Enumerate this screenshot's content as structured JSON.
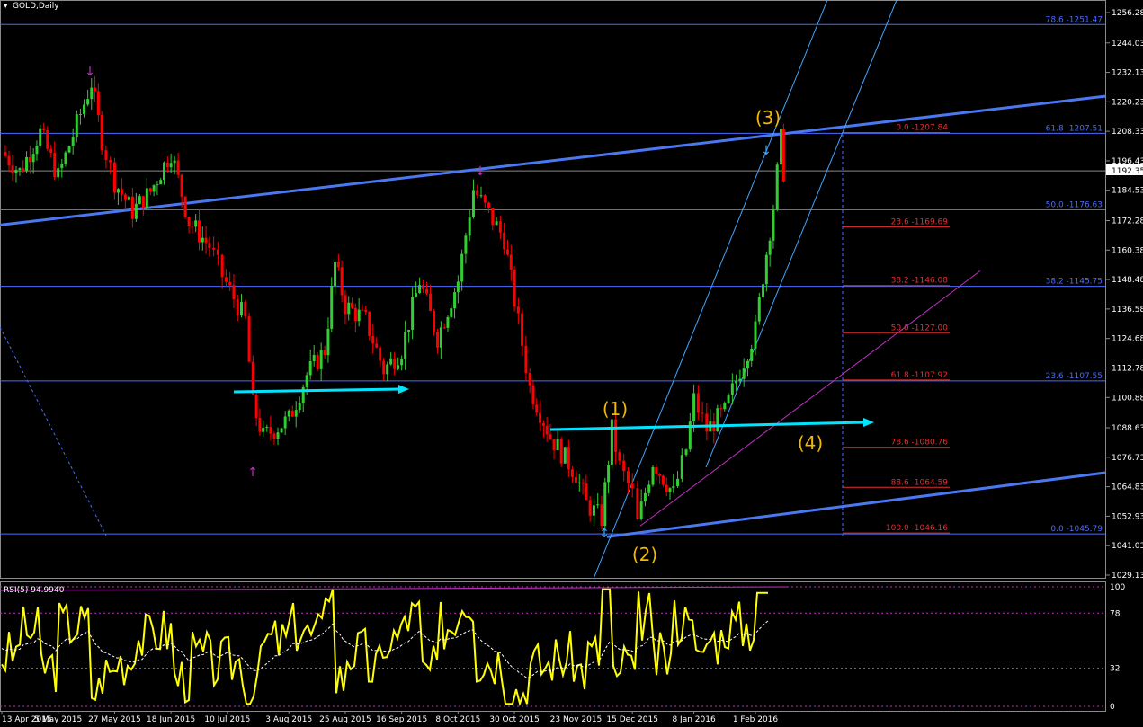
{
  "title": "GOLD,Daily",
  "indicator": {
    "label": "RSI(5) 94.9940"
  },
  "current_price": "1192.35",
  "colors": {
    "background": "#000000",
    "bull_candle": "#32cd32",
    "bear_candle": "#ff0000",
    "fib_blue": "#4a6cff",
    "fib_red": "#e23030",
    "trendline": "#4a78f0",
    "channel": "#40a6ff",
    "arrow": "#00e5ff",
    "wave_label": "#f5b800",
    "rsi": "#ffff00",
    "fractal": "#c030c0",
    "axis_text": "#ffffff"
  },
  "chart_data": {
    "type": "candlestick",
    "title": "GOLD,Daily",
    "ylim": [
      1024,
      1262
    ],
    "y_ticks": [
      "1256.28",
      "1244.03",
      "1232.13",
      "1220.23",
      "1208.33",
      "1196.43",
      "1184.53",
      "1172.28",
      "1160.38",
      "1148.48",
      "1136.58",
      "1124.68",
      "1112.78",
      "1100.88",
      "1088.63",
      "1076.73",
      "1064.83",
      "1052.93",
      "1041.03",
      "1029.13"
    ],
    "x_ticks": [
      "13 Apr 2015",
      "5 May 2015",
      "27 May 2015",
      "18 Jun 2015",
      "10 Jul 2015",
      "3 Aug 2015",
      "25 Aug 2015",
      "16 Sep 2015",
      "8 Oct 2015",
      "30 Oct 2015",
      "23 Nov 2015",
      "15 Dec 2015",
      "8 Jan 2016",
      "1 Feb 2016"
    ],
    "close_path": [
      {
        "date": "13 Apr 2015",
        "close": 1200
      },
      {
        "date": "20 Apr 2015",
        "close": 1192
      },
      {
        "date": "28 Apr 2015",
        "close": 1208
      },
      {
        "date": "5 May 2015",
        "close": 1190
      },
      {
        "date": "18 May 2015",
        "close": 1228
      },
      {
        "date": "22 May 2015",
        "close": 1205
      },
      {
        "date": "27 May 2015",
        "close": 1188
      },
      {
        "date": "3 Jun 2015",
        "close": 1176
      },
      {
        "date": "10 Jun 2015",
        "close": 1184
      },
      {
        "date": "18 Jun 2015",
        "close": 1200
      },
      {
        "date": "25 Jun 2015",
        "close": 1172
      },
      {
        "date": "3 Jul 2015",
        "close": 1162
      },
      {
        "date": "8 Jul 2015",
        "close": 1150
      },
      {
        "date": "17 Jul 2015",
        "close": 1132
      },
      {
        "date": "20 Jul 2015",
        "close": 1098
      },
      {
        "date": "24 Jul 2015",
        "close": 1085
      },
      {
        "date": "3 Aug 2015",
        "close": 1092
      },
      {
        "date": "10 Aug 2015",
        "close": 1110
      },
      {
        "date": "17 Aug 2015",
        "close": 1120
      },
      {
        "date": "21 Aug 2015",
        "close": 1155
      },
      {
        "date": "25 Aug 2015",
        "close": 1138
      },
      {
        "date": "2 Sep 2015",
        "close": 1132
      },
      {
        "date": "9 Sep 2015",
        "close": 1112
      },
      {
        "date": "16 Sep 2015",
        "close": 1120
      },
      {
        "date": "23 Sep 2015",
        "close": 1148
      },
      {
        "date": "30 Sep 2015",
        "close": 1125
      },
      {
        "date": "8 Oct 2015",
        "close": 1148
      },
      {
        "date": "14 Oct 2015",
        "close": 1185
      },
      {
        "date": "20 Oct 2015",
        "close": 1175
      },
      {
        "date": "26 Oct 2015",
        "close": 1165
      },
      {
        "date": "30 Oct 2015",
        "close": 1140
      },
      {
        "date": "5 Nov 2015",
        "close": 1105
      },
      {
        "date": "13 Nov 2015",
        "close": 1085
      },
      {
        "date": "23 Nov 2015",
        "close": 1070
      },
      {
        "date": "27 Nov 2015",
        "close": 1058
      },
      {
        "date": "3 Dec 2015",
        "close": 1052
      },
      {
        "date": "7 Dec 2015",
        "close": 1088
      },
      {
        "date": "10 Dec 2015",
        "close": 1073
      },
      {
        "date": "15 Dec 2015",
        "close": 1062
      },
      {
        "date": "17 Dec 2015",
        "close": 1050
      },
      {
        "date": "23 Dec 2015",
        "close": 1075
      },
      {
        "date": "31 Dec 2015",
        "close": 1062
      },
      {
        "date": "5 Jan 2016",
        "close": 1080
      },
      {
        "date": "8 Jan 2016",
        "close": 1100
      },
      {
        "date": "13 Jan 2016",
        "close": 1088
      },
      {
        "date": "20 Jan 2016",
        "close": 1095
      },
      {
        "date": "26 Jan 2016",
        "close": 1112
      },
      {
        "date": "1 Feb 2016",
        "close": 1128
      },
      {
        "date": "4 Feb 2016",
        "close": 1150
      },
      {
        "date": "8 Feb 2016",
        "close": 1178
      },
      {
        "date": "11 Feb 2016",
        "close": 1205
      },
      {
        "date": "12 Feb 2016",
        "close": 1192
      }
    ],
    "fib_levels_left": [
      {
        "label": "78.6 -1251.47",
        "value": 1251.47
      },
      {
        "label": "61.8 -1207.51",
        "value": 1207.51
      },
      {
        "label": "50.0 -1176.63",
        "value": 1176.63
      },
      {
        "label": "38.2 -1145.75",
        "value": 1145.75
      },
      {
        "label": "23.6 -1107.55",
        "value": 1107.55
      },
      {
        "label": "0.0 -1045.79",
        "value": 1045.79
      }
    ],
    "fib_levels_right": [
      {
        "label": "0.0 -1207.84",
        "value": 1207.84
      },
      {
        "label": "23.6 -1169.69",
        "value": 1169.69
      },
      {
        "label": "38.2 -1146.08",
        "value": 1146.08
      },
      {
        "label": "50.0 -1127.00",
        "value": 1127.0
      },
      {
        "label": "61.8 -1107.92",
        "value": 1107.92
      },
      {
        "label": "78.6 -1080.76",
        "value": 1080.76
      },
      {
        "label": "88.6 -1064.59",
        "value": 1064.59
      },
      {
        "label": "100.0 -1046.16",
        "value": 1046.16
      }
    ],
    "wave_labels": [
      "(1)",
      "(2)",
      "(3)",
      "(4)"
    ],
    "rsi": {
      "label": "RSI(5) 94.9940",
      "ylim": [
        0,
        100
      ],
      "levels": [
        "100",
        "78",
        "32",
        "0"
      ],
      "level_values": [
        100,
        78,
        32,
        0
      ],
      "current": 94.994
    }
  }
}
